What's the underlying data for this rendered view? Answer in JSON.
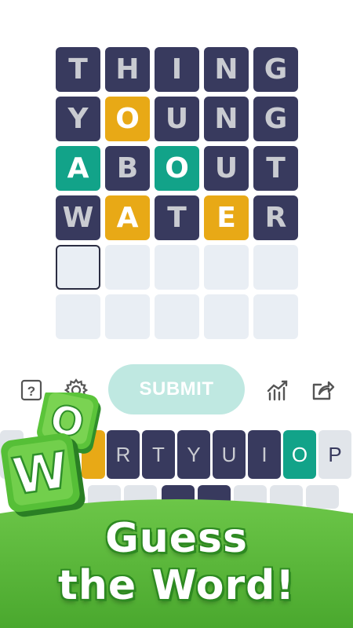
{
  "board": {
    "rows": [
      [
        {
          "letter": "T",
          "state": "absent"
        },
        {
          "letter": "H",
          "state": "absent"
        },
        {
          "letter": "I",
          "state": "absent"
        },
        {
          "letter": "N",
          "state": "absent"
        },
        {
          "letter": "G",
          "state": "absent"
        }
      ],
      [
        {
          "letter": "Y",
          "state": "absent"
        },
        {
          "letter": "O",
          "state": "present"
        },
        {
          "letter": "U",
          "state": "absent"
        },
        {
          "letter": "N",
          "state": "absent"
        },
        {
          "letter": "G",
          "state": "absent"
        }
      ],
      [
        {
          "letter": "A",
          "state": "correct"
        },
        {
          "letter": "B",
          "state": "absent"
        },
        {
          "letter": "O",
          "state": "correct"
        },
        {
          "letter": "U",
          "state": "absent"
        },
        {
          "letter": "T",
          "state": "absent"
        }
      ],
      [
        {
          "letter": "W",
          "state": "absent"
        },
        {
          "letter": "A",
          "state": "present"
        },
        {
          "letter": "T",
          "state": "absent"
        },
        {
          "letter": "E",
          "state": "present"
        },
        {
          "letter": "R",
          "state": "absent"
        }
      ],
      [
        {
          "letter": "",
          "state": "active"
        },
        {
          "letter": "",
          "state": "empty"
        },
        {
          "letter": "",
          "state": "empty"
        },
        {
          "letter": "",
          "state": "empty"
        },
        {
          "letter": "",
          "state": "empty"
        }
      ],
      [
        {
          "letter": "",
          "state": "empty"
        },
        {
          "letter": "",
          "state": "empty"
        },
        {
          "letter": "",
          "state": "empty"
        },
        {
          "letter": "",
          "state": "empty"
        },
        {
          "letter": "",
          "state": "empty"
        }
      ]
    ]
  },
  "toolbar": {
    "help_icon": "question-mark-icon",
    "settings_icon": "gear-icon",
    "submit_label": "SUBMIT",
    "stats_icon": "stats-chart-icon",
    "share_icon": "share-icon"
  },
  "keyboard": {
    "row1": [
      {
        "key": "R",
        "state": "absent"
      },
      {
        "key": "T",
        "state": "absent"
      },
      {
        "key": "Y",
        "state": "absent"
      },
      {
        "key": "U",
        "state": "absent"
      },
      {
        "key": "I",
        "state": "absent"
      },
      {
        "key": "O",
        "state": "correct"
      },
      {
        "key": "P",
        "state": "light"
      }
    ]
  },
  "promo": {
    "line1": "Guess",
    "line2": "the Word!"
  },
  "logo": {
    "letter_top": "O",
    "letter_bottom": "W"
  },
  "colors": {
    "absent": "#383a5e",
    "present": "#e8a916",
    "correct": "#12a389",
    "empty": "#e9eef4",
    "submit": "#bfe8e1",
    "banner_green": "#56b83a"
  }
}
